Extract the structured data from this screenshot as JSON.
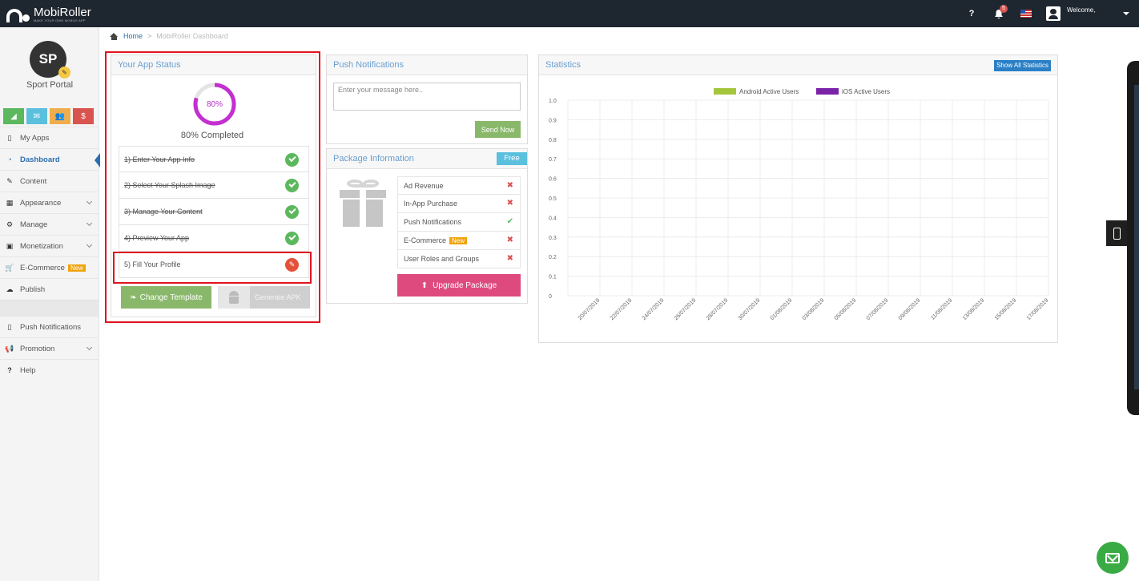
{
  "header": {
    "logo_name": "MobiRoller",
    "logo_tagline": "MAKE YOUR OWN MOBILE APP",
    "help_label": "?",
    "notification_count": "5",
    "welcome_text": "Welcome,"
  },
  "sidebar": {
    "avatar_initials": "SP",
    "app_name": "Sport Portal",
    "quick_buttons": [
      {
        "icon": "bar-chart-icon",
        "color": "#5cb85c"
      },
      {
        "icon": "envelope-icon",
        "color": "#5bc0de"
      },
      {
        "icon": "users-icon",
        "color": "#f0ad4e"
      },
      {
        "icon": "dollar-icon",
        "color": "#d9534f"
      }
    ],
    "items": [
      {
        "label": "My Apps",
        "icon": "mobile-icon"
      },
      {
        "label": "Dashboard",
        "icon": "dashboard-icon",
        "active": true
      },
      {
        "label": "Content",
        "icon": "edit-icon"
      },
      {
        "label": "Appearance",
        "icon": "grid-icon"
      },
      {
        "label": "Manage",
        "icon": "cogs-icon"
      },
      {
        "label": "Monetization",
        "icon": "money-icon"
      },
      {
        "label": "E-Commerce",
        "icon": "cart-icon",
        "badge": "New"
      },
      {
        "label": "Publish",
        "icon": "cloud-upload-icon"
      },
      {
        "label": "Push Notifications",
        "icon": "mobile-icon"
      },
      {
        "label": "Promotion",
        "icon": "bullhorn-icon"
      },
      {
        "label": "Help",
        "icon": "question-icon"
      }
    ]
  },
  "breadcrumb": {
    "home": "Home",
    "separator": ">",
    "current": "MobiRoller Dashboard"
  },
  "app_status": {
    "title": "Your App Status",
    "progress": 80,
    "progress_label": "80%",
    "completed_text": "80% Completed",
    "steps": [
      {
        "label": "1) Enter Your App Info",
        "done": true
      },
      {
        "label": "2) Select Your Splash Image",
        "done": true
      },
      {
        "label": "3) Manage Your Content",
        "done": true
      },
      {
        "label": "4) Preview Your App",
        "done": true
      },
      {
        "label": "5) Fill Your Profile",
        "done": false
      }
    ],
    "change_template_label": "Change Template",
    "generate_apk_label": "Generate APK"
  },
  "push": {
    "title": "Push Notifications",
    "placeholder": "Enter your message here..",
    "send_label": "Send Now"
  },
  "package": {
    "title": "Package Information",
    "plan": "Free",
    "features": [
      {
        "label": "Ad Revenue",
        "enabled": false
      },
      {
        "label": "In-App Purchase",
        "enabled": false
      },
      {
        "label": "Push Notifications",
        "enabled": true
      },
      {
        "label": "E-Commerce",
        "enabled": false,
        "badge": "New"
      },
      {
        "label": "User Roles and Groups",
        "enabled": false
      }
    ],
    "upgrade_label": "Upgrade Package"
  },
  "statistics": {
    "title": "Statistics",
    "show_all_label": "Show All Statistics"
  },
  "chart_data": {
    "type": "line",
    "x": [
      "20/07/2019",
      "22/07/2019",
      "24/07/2019",
      "26/07/2019",
      "28/07/2019",
      "30/07/2019",
      "01/08/2019",
      "03/08/2019",
      "05/08/2019",
      "07/08/2019",
      "09/08/2019",
      "11/08/2019",
      "13/08/2019",
      "15/08/2019",
      "17/08/2019"
    ],
    "y_ticks": [
      "0",
      "0.1",
      "0.2",
      "0.3",
      "0.4",
      "0.5",
      "0.6",
      "0.7",
      "0.8",
      "0.9",
      "1.0"
    ],
    "ylim": [
      0,
      1.0
    ],
    "series": [
      {
        "name": "Android Active Users",
        "color": "#a4c63c",
        "values": []
      },
      {
        "name": "iOS Active Users",
        "color": "#7a22a8",
        "values": []
      }
    ],
    "grid": true,
    "legend": "top-center"
  },
  "colors": {
    "accent": "#2a6fb0",
    "ring": "#c32fd1",
    "highlight": "#e0141e"
  }
}
